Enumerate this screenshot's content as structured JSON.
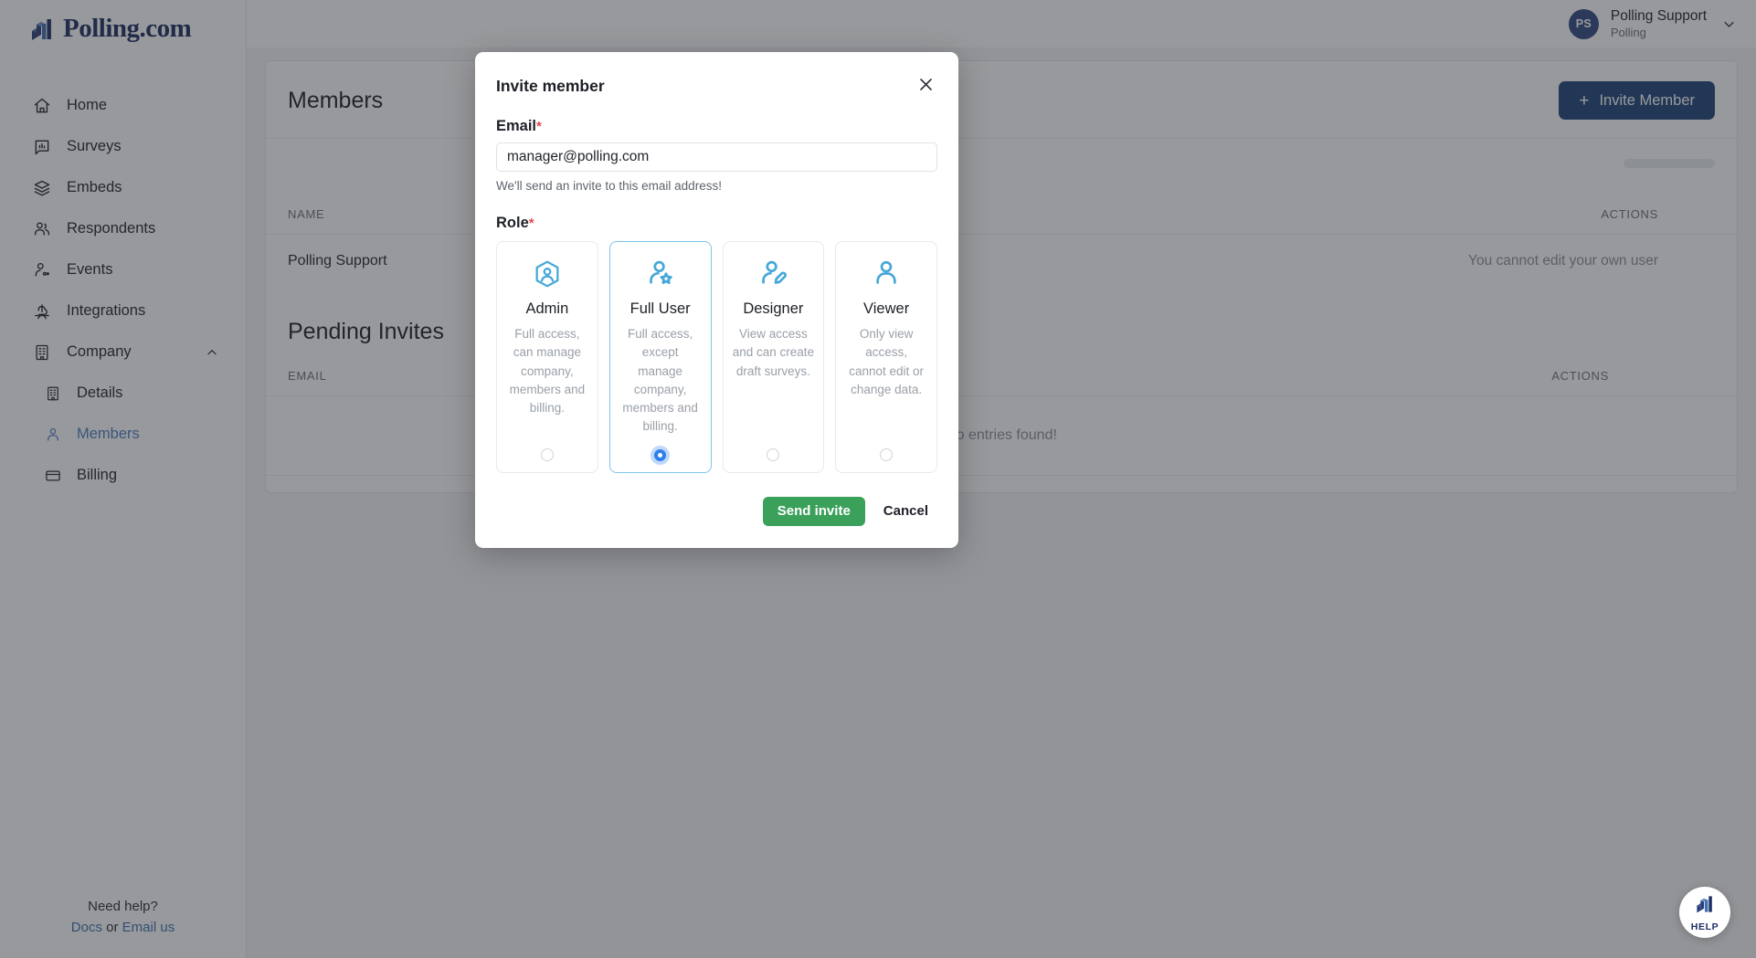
{
  "brand": {
    "name": "Polling.com",
    "logo_icon": "polling-bar-logo",
    "primary_color": "#1d4477",
    "accent_color": "#46a8d8",
    "success_color": "#3aa05a",
    "required_color": "#e5484d"
  },
  "sidebar": {
    "items": [
      {
        "label": "Home",
        "icon": "home-icon",
        "level": 0,
        "active": false
      },
      {
        "label": "Surveys",
        "icon": "survey-chart-icon",
        "level": 0,
        "active": false
      },
      {
        "label": "Embeds",
        "icon": "layers-icon",
        "level": 0,
        "active": false
      },
      {
        "label": "Respondents",
        "icon": "users-icon",
        "level": 0,
        "active": false
      },
      {
        "label": "Events",
        "icon": "user-activity-icon",
        "level": 0,
        "active": false
      },
      {
        "label": "Integrations",
        "icon": "integration-cloud-icon",
        "level": 0,
        "active": false
      },
      {
        "label": "Company",
        "icon": "building-icon",
        "level": 0,
        "active": false,
        "expanded": true,
        "chevron": "chevron-up-icon"
      },
      {
        "label": "Details",
        "icon": "building-small-icon",
        "level": 1,
        "active": false
      },
      {
        "label": "Members",
        "icon": "person-icon",
        "level": 1,
        "active": true
      },
      {
        "label": "Billing",
        "icon": "credit-card-icon",
        "level": 1,
        "active": false
      }
    ],
    "footer": {
      "need_help": "Need help?",
      "docs_label": "Docs",
      "or_label": "or",
      "email_label": "Email us"
    }
  },
  "header": {
    "avatar_initials": "PS",
    "user_name": "Polling Support",
    "organization": "Polling",
    "chevron_icon": "chevron-down-icon"
  },
  "main": {
    "page_title": "Members",
    "invite_button": {
      "label": "Invite Member",
      "icon": "plus-icon"
    },
    "members_table": {
      "columns": [
        "NAME",
        "ACTIONS"
      ],
      "rows": [
        {
          "name": "Polling Support",
          "actions": "You cannot edit your own user"
        }
      ]
    },
    "pending_invites": {
      "title": "Pending Invites",
      "columns": [
        "EMAIL",
        "ACTIONS"
      ],
      "empty_message": "No entries found!"
    }
  },
  "help_fab": {
    "label": "HELP",
    "icon": "polling-bar-logo"
  },
  "modal": {
    "title": "Invite member",
    "close_icon": "close-icon",
    "email": {
      "label": "Email",
      "required_marker": "*",
      "value": "manager@polling.com",
      "placeholder": "",
      "help_text": "We'll send an invite to this email address!"
    },
    "role": {
      "label": "Role",
      "required_marker": "*",
      "options": [
        {
          "name": "Admin",
          "description": "Full access, can manage company, members and billing.",
          "icon": "hexagon-person-icon",
          "selected": false
        },
        {
          "name": "Full User",
          "description": "Full access, except manage company, members and billing.",
          "icon": "person-star-icon",
          "selected": true
        },
        {
          "name": "Designer",
          "description": "View access and can create draft surveys.",
          "icon": "person-pencil-icon",
          "selected": false
        },
        {
          "name": "Viewer",
          "description": "Only view access, cannot edit or change data.",
          "icon": "person-icon",
          "selected": false
        }
      ]
    },
    "actions": {
      "submit_label": "Send invite",
      "cancel_label": "Cancel"
    }
  }
}
